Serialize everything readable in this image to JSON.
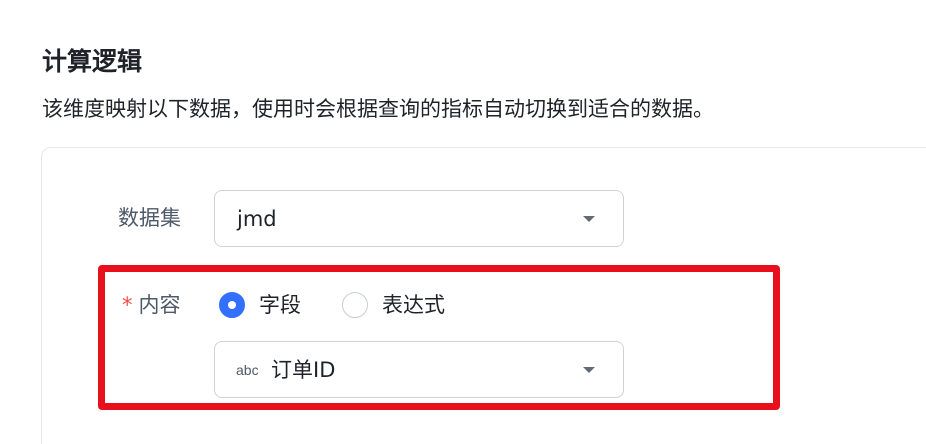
{
  "section": {
    "title": "计算逻辑",
    "description": "该维度映射以下数据，使用时会根据查询的指标自动切换到适合的数据。"
  },
  "form": {
    "dataset": {
      "label": "数据集",
      "value": "jmd"
    },
    "content": {
      "required_mark": "*",
      "label": "内容",
      "options": [
        {
          "label": "字段",
          "selected": true
        },
        {
          "label": "表达式",
          "selected": false
        }
      ],
      "field_select": {
        "type_icon": "abc",
        "value": "订单ID"
      }
    }
  },
  "colors": {
    "accent": "#3370ff",
    "highlight": "#e8101d",
    "required": "#f54a45"
  }
}
